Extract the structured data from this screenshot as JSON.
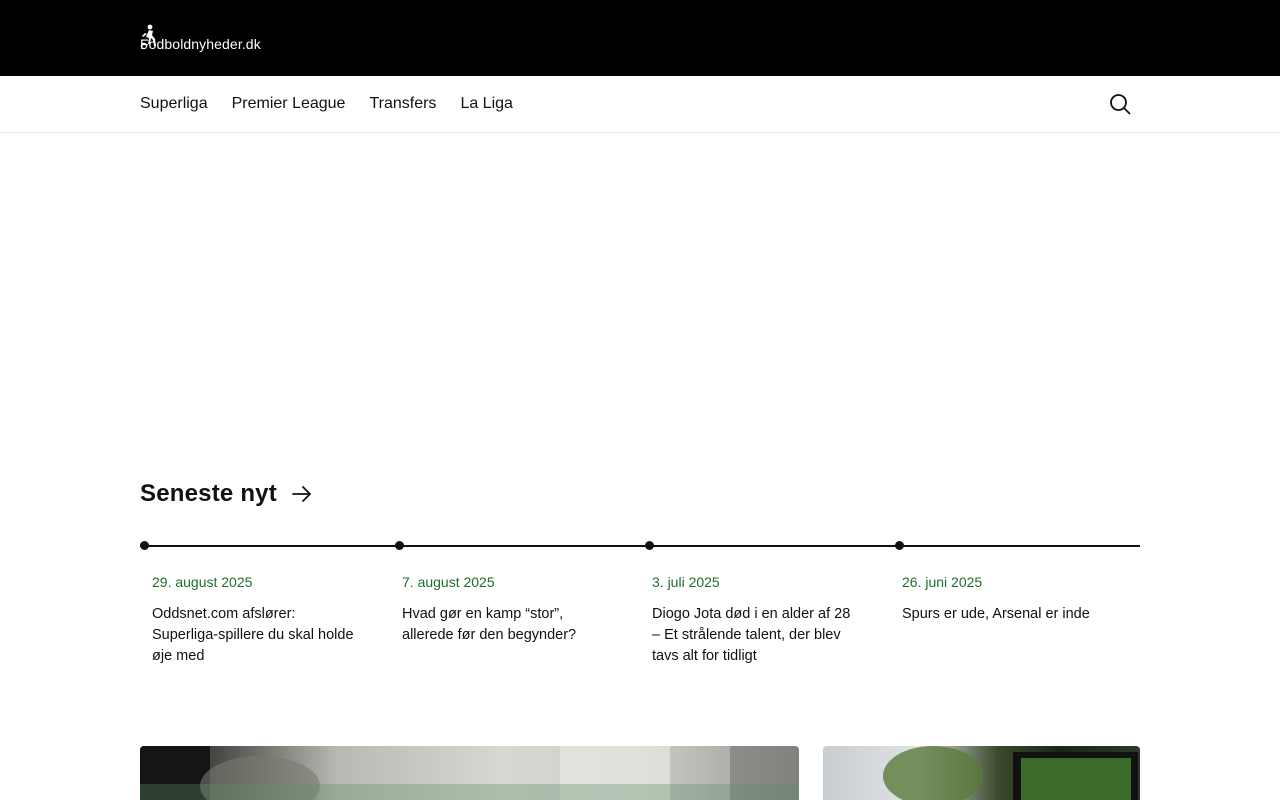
{
  "header": {
    "site_name": "Fodboldnyheder.dk",
    "logo_icon": "footballer-icon"
  },
  "nav": {
    "items": [
      {
        "label": "Superliga"
      },
      {
        "label": "Premier League"
      },
      {
        "label": "Transfers"
      },
      {
        "label": "La Liga"
      }
    ],
    "search_icon": "search-icon"
  },
  "latest": {
    "title": "Seneste nyt",
    "title_icon": "arrow-right-icon",
    "items": [
      {
        "date": "29. august 2025",
        "title": "Oddsnet.com afslører: Superliga-spillere du skal holde øje med"
      },
      {
        "date": "7. august 2025",
        "title": "Hvad gør en kamp “stor”, allerede før den begynder?"
      },
      {
        "date": "3. juli 2025",
        "title": "Diogo Jota død i en alder af 28 – Et strålende talent, der blev tavs alt for tidligt"
      },
      {
        "date": "26. juni 2025",
        "title": "Spurs er ude, Arsenal er inde"
      }
    ]
  },
  "colors": {
    "topbar_bg": "#000000",
    "date_accent": "#1f6e2e",
    "text": "#111111"
  }
}
